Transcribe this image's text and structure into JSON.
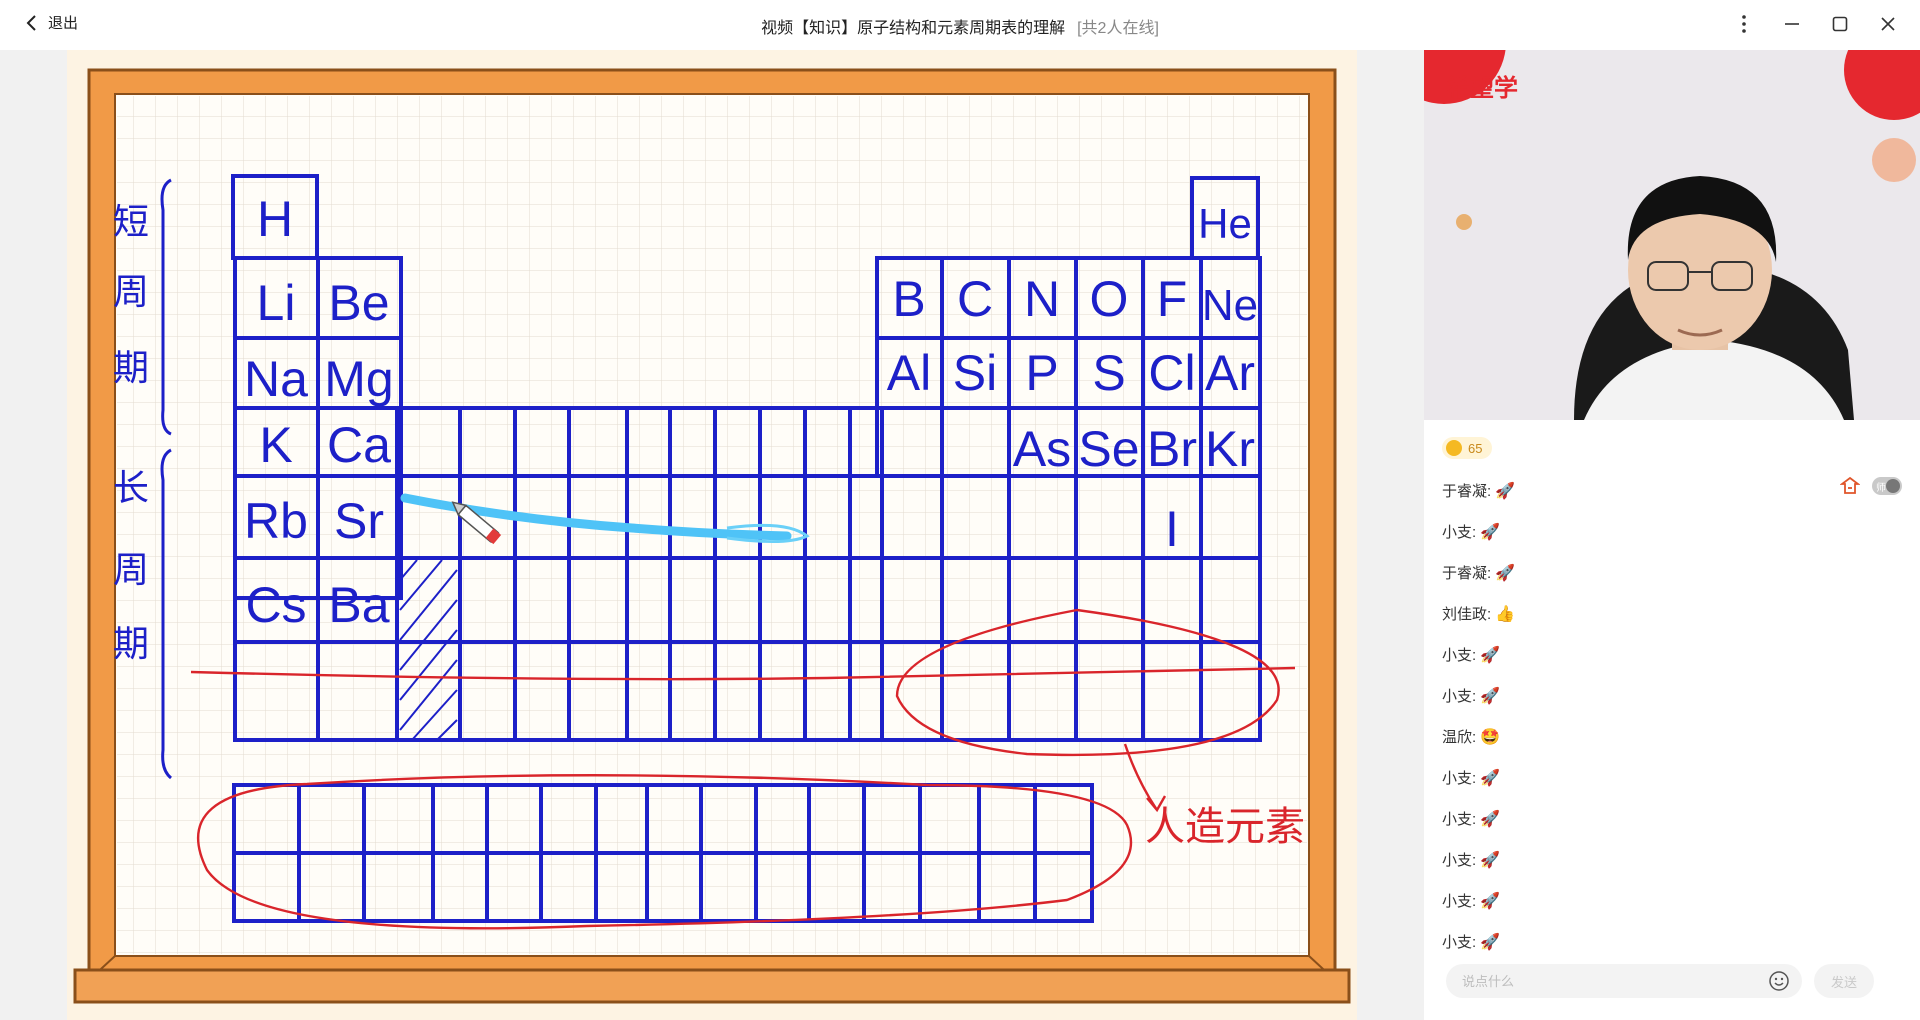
{
  "window": {
    "back_label": "退出",
    "title": "视频【知识】原子结构和元素周期表的理解",
    "online": "[共2人在线]"
  },
  "icons": [
    "chevron-left-icon",
    "more-vertical-icon",
    "minimize-icon",
    "maximize-icon",
    "close-icon",
    "emoji-icon",
    "teacher-icon"
  ],
  "colors": {
    "ink_blue": "#1d20c8",
    "ink_red": "#d9252b",
    "highlight": "#4fc3f7",
    "frame": "#e98d3b"
  },
  "board": {
    "elements_row1": [
      "H",
      "He"
    ],
    "elements_row2": [
      "Li",
      "Be",
      "B",
      "C",
      "N",
      "O",
      "F",
      "Ne"
    ],
    "elements_row3": [
      "Na",
      "Mg",
      "Al",
      "Si",
      "P",
      "S",
      "Cl",
      "Ar"
    ],
    "elements_row4": [
      "K",
      "Ca",
      "As",
      "Se",
      "Br",
      "Kr"
    ],
    "elements_row5": [
      "Rb",
      "Sr",
      "I"
    ],
    "elements_row6": [
      "Cs",
      "Ba"
    ],
    "short_period_label": [
      "短",
      "周",
      "期"
    ],
    "long_period_label": [
      "长",
      "周",
      "期"
    ],
    "note_label": "人造元素"
  },
  "video": {
    "brand": "希望学"
  },
  "likes": {
    "count": "65"
  },
  "chat": {
    "toggle_label": "师",
    "messages": [
      {
        "user": "于睿凝:",
        "emoji": "🚀"
      },
      {
        "user": "小支:",
        "emoji": "🚀"
      },
      {
        "user": "于睿凝:",
        "emoji": "🚀"
      },
      {
        "user": "刘佳政:",
        "emoji": "👍"
      },
      {
        "user": "小支:",
        "emoji": "🚀"
      },
      {
        "user": "小支:",
        "emoji": "🚀"
      },
      {
        "user": "温欣:",
        "emoji": "🤩"
      },
      {
        "user": "小支:",
        "emoji": "🚀"
      },
      {
        "user": "小支:",
        "emoji": "🚀"
      },
      {
        "user": "小支:",
        "emoji": "🚀"
      },
      {
        "user": "小支:",
        "emoji": "🚀"
      },
      {
        "user": "小支:",
        "emoji": "🚀"
      }
    ],
    "input_placeholder": "说点什么",
    "send_label": "发送"
  }
}
